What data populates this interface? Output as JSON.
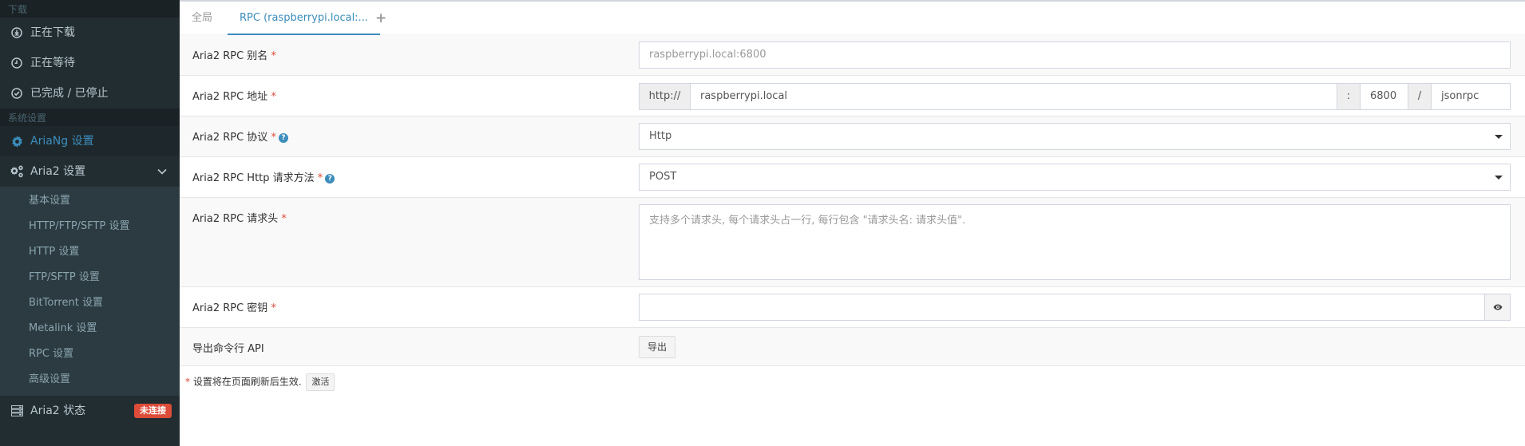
{
  "sidebar": {
    "section_download": "下载",
    "downloading": "正在下载",
    "waiting": "正在等待",
    "stopped": "已完成 / 已停止",
    "section_settings": "系统设置",
    "ariang_settings": "AriaNg 设置",
    "aria2_settings": "Aria2 设置",
    "sub_items": [
      "基本设置",
      "HTTP/FTP/SFTP 设置",
      "HTTP 设置",
      "FTP/SFTP 设置",
      "BitTorrent 设置",
      "Metalink 设置",
      "RPC 设置",
      "高级设置"
    ],
    "aria2_status": "Aria2 状态",
    "status_badge": "未连接"
  },
  "tabs": {
    "global": "全局",
    "rpc": "RPC (raspberrypi.local:...",
    "add": "+"
  },
  "form": {
    "alias_label": "Aria2 RPC 别名",
    "alias_placeholder": "raspberrypi.local:6800",
    "address_label": "Aria2 RPC 地址",
    "address_protocol": "http://",
    "address_host": "raspberrypi.local",
    "address_colon": ":",
    "address_port": "6800",
    "address_slash": "/",
    "address_path": "jsonrpc",
    "protocol_label": "Aria2 RPC 协议",
    "protocol_value": "Http",
    "method_label": "Aria2 RPC Http 请求方法",
    "method_value": "POST",
    "headers_label": "Aria2 RPC 请求头",
    "headers_placeholder": "支持多个请求头, 每个请求头占一行, 每行包含 \"请求头名: 请求头值\".",
    "secret_label": "Aria2 RPC 密钥",
    "secret_value": "",
    "export_label": "导出命令行 API",
    "export_button": "导出",
    "required_mark": "*",
    "help_mark": "?"
  },
  "footnote": {
    "text": "设置将在页面刷新后生效.",
    "activate_button": "激活"
  },
  "colors": {
    "sidebar_bg": "#222d32",
    "accent": "#3c8dbc",
    "danger": "#dd4b39"
  }
}
